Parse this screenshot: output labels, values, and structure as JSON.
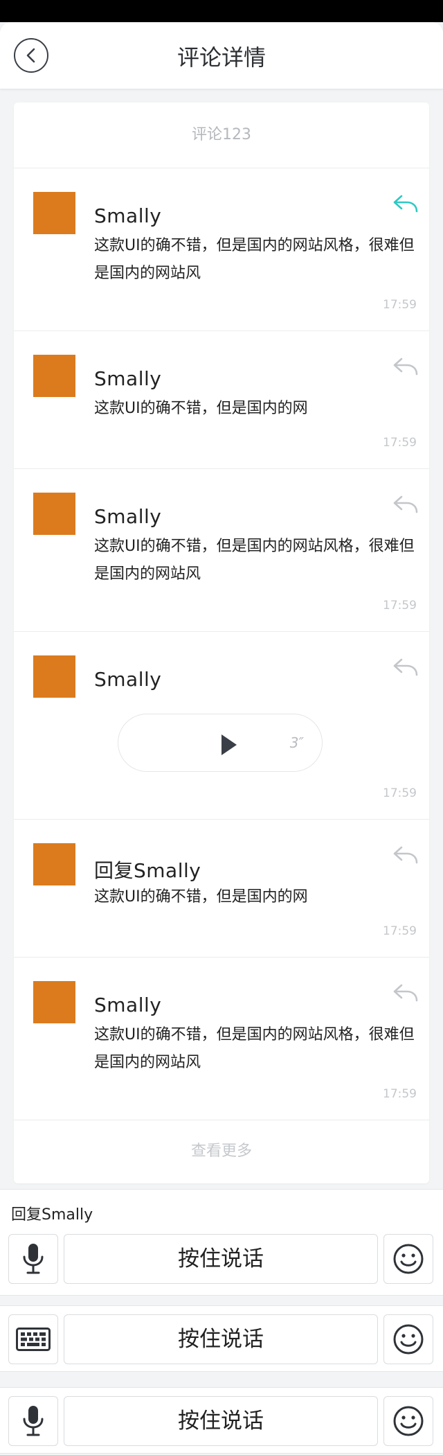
{
  "header": {
    "title": "评论详情"
  },
  "card": {
    "title": "评论123",
    "more_label": "查看更多",
    "comments": [
      {
        "name": "Smally",
        "text": "这款UI的确不错，但是国内的网站风格，很难但是国内的网站风",
        "time": "17:59",
        "reply_active": true
      },
      {
        "name": "Smally",
        "text": "这款UI的确不错，但是国内的网",
        "time": "17:59",
        "reply_active": false
      },
      {
        "name": "Smally",
        "text": "这款UI的确不错，但是国内的网站风格，很难但是国内的网站风",
        "time": "17:59",
        "reply_active": false
      },
      {
        "name": "Smally",
        "voice_duration": "3″",
        "time": "17:59",
        "reply_active": false
      },
      {
        "name": "回复Smally",
        "text": "这款UI的确不错，但是国内的网",
        "time": "17:59",
        "reply_active": false
      },
      {
        "name": "Smally",
        "text": "这款UI的确不错，但是国内的网站风格，很难但是国内的网站风",
        "time": "17:59",
        "reply_active": false
      }
    ]
  },
  "reply_bar": {
    "label": "回复Smally",
    "talk_label": "按住说话"
  },
  "bars": [
    {
      "left_icon": "microphone-icon",
      "talk_label": "按住说话",
      "right_icon": "smiley-icon"
    },
    {
      "left_icon": "keyboard-icon",
      "talk_label": "按住说话",
      "right_icon": "smiley-icon"
    },
    {
      "left_icon": "microphone-icon",
      "talk_label": "按住说话",
      "right_icon": "smiley-icon"
    }
  ],
  "colors": {
    "accent": "#2ec9c4",
    "avatar": "#db7b1d",
    "muted": "#c4c7cb"
  }
}
